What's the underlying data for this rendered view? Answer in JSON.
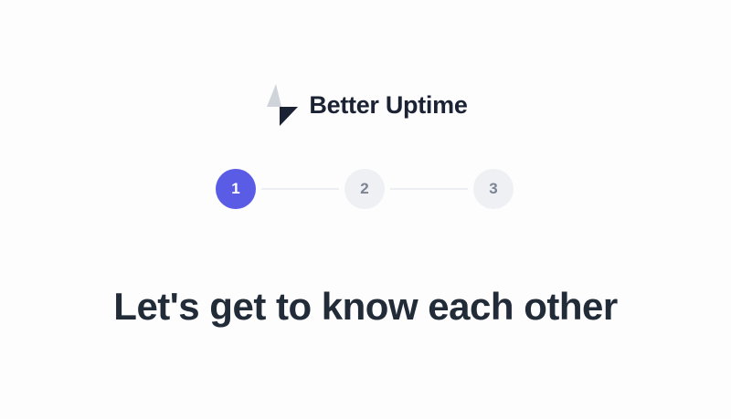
{
  "brand": {
    "name": "Better Uptime",
    "icon": "lightning-bolt-icon",
    "colors": {
      "text": "#1a2233",
      "bolt_dark": "#1a2233",
      "bolt_light": "#cfd3da"
    }
  },
  "stepper": {
    "steps": [
      {
        "label": "1",
        "state": "active"
      },
      {
        "label": "2",
        "state": "inactive"
      },
      {
        "label": "3",
        "state": "inactive"
      }
    ],
    "colors": {
      "active_bg": "#5b5ce6",
      "active_text": "#ffffff",
      "inactive_bg": "#eef0f3",
      "inactive_text": "#7c8494",
      "connector": "#eceef1"
    }
  },
  "main": {
    "heading": "Let's get to know each other"
  }
}
